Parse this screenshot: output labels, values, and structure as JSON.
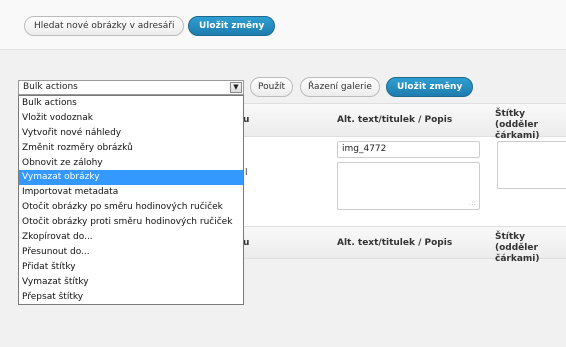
{
  "top_toolbar": {
    "scan_button": "Hledat nové obrázky v adresáři",
    "save_button": "Uložit změny"
  },
  "actions_bar": {
    "bulk_select_value": "Bulk actions",
    "apply_button": "Použít",
    "sort_button": "Řazení galerie",
    "save_button": "Uložit změny"
  },
  "bulk_options": [
    "Bulk actions",
    "Vložit vodoznak",
    "Vytvořit nové náhledy",
    "Změnit rozměry obrázků",
    "Obnovit ze zálohy",
    "Vymazat obrázky",
    "Importovat metadata",
    "Otočit obrázky po směru hodinových ručiček",
    "Otočit obrázky proti směru hodinových ručiček",
    "Zkopírovat do...",
    "Přesunout do...",
    "Přidat štítky",
    "Vymazat štítky",
    "Přepsat štítky"
  ],
  "selected_option_index": 5,
  "table": {
    "col_partial_header": "u",
    "col_alt_header": "Alt. text/titulek / Popis",
    "col_tags_header_line1": "Štítky (odděler",
    "col_tags_header_line2": "čárkami)",
    "row_partial_char": "l",
    "row_alt_value": "img_4772",
    "textarea_grip": ".::"
  }
}
